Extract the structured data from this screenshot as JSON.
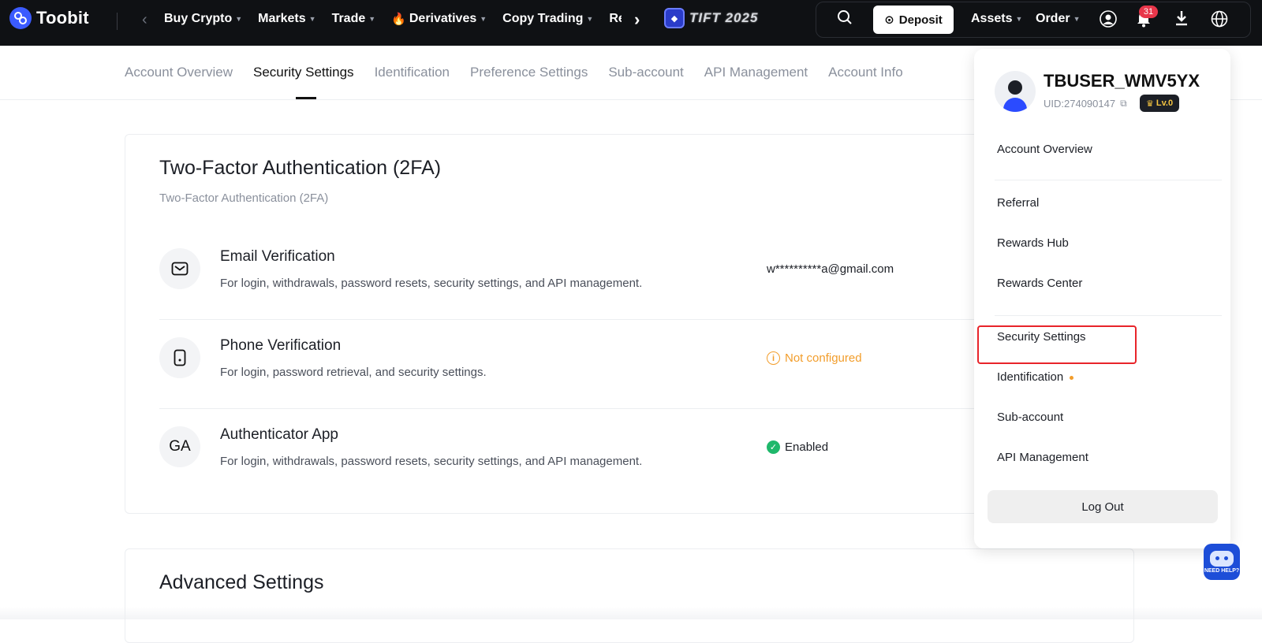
{
  "brand": {
    "name": "Toobit",
    "accent": "#3b5bff"
  },
  "topnav": {
    "items": [
      {
        "label": "Buy Crypto",
        "dropdown": true
      },
      {
        "label": "Markets",
        "dropdown": true
      },
      {
        "label": "Trade",
        "dropdown": true
      },
      {
        "label": "Derivatives",
        "dropdown": true,
        "icon": "flame-icon"
      },
      {
        "label": "Copy Trading",
        "dropdown": true
      },
      {
        "label": "Rewa",
        "dropdown": false
      }
    ],
    "promo_label": "TIFT 2025",
    "deposit_label": "Deposit",
    "assets_label": "Assets",
    "order_label": "Order",
    "notification_count": "31"
  },
  "tabs": [
    {
      "label": "Account Overview",
      "active": false
    },
    {
      "label": "Security Settings",
      "active": true
    },
    {
      "label": "Identification",
      "active": false
    },
    {
      "label": "Preference Settings",
      "active": false
    },
    {
      "label": "Sub-account",
      "active": false
    },
    {
      "label": "API Management",
      "active": false
    },
    {
      "label": "Account Info",
      "active": false
    }
  ],
  "twofa": {
    "title": "Two-Factor Authentication (2FA)",
    "subtitle": "Two-Factor Authentication (2FA)",
    "rows": [
      {
        "icon": "mail-icon",
        "title": "Email Verification",
        "desc": "For login, withdrawals, password resets, security settings, and API management.",
        "status": "w**********a@gmail.com",
        "status_type": "value"
      },
      {
        "icon": "phone-icon",
        "title": "Phone Verification",
        "desc": "For login, password retrieval, and security settings.",
        "status": "Not configured",
        "status_type": "warning"
      },
      {
        "icon_text": "GA",
        "title": "Authenticator App",
        "desc": "For login, withdrawals, password resets, security settings, and API management.",
        "status": "Enabled",
        "status_type": "enabled"
      }
    ]
  },
  "advanced": {
    "title": "Advanced Settings"
  },
  "dropdown": {
    "username": "TBUSER_WMV5YX",
    "uid": "UID:274090147",
    "level": "Lv.0",
    "items": {
      "account_overview": "Account Overview",
      "referral": "Referral",
      "rewards_hub": "Rewards Hub",
      "rewards_center": "Rewards Center",
      "security_settings": "Security Settings",
      "identification": "Identification",
      "sub_account": "Sub-account",
      "api_management": "API Management"
    },
    "logout": "Log Out"
  },
  "help": {
    "label": "NEED HELP?"
  },
  "colors": {
    "warning": "#f29d2b",
    "success": "#1fb86b",
    "highlight": "#e8242a",
    "badge": "#e8364a"
  }
}
